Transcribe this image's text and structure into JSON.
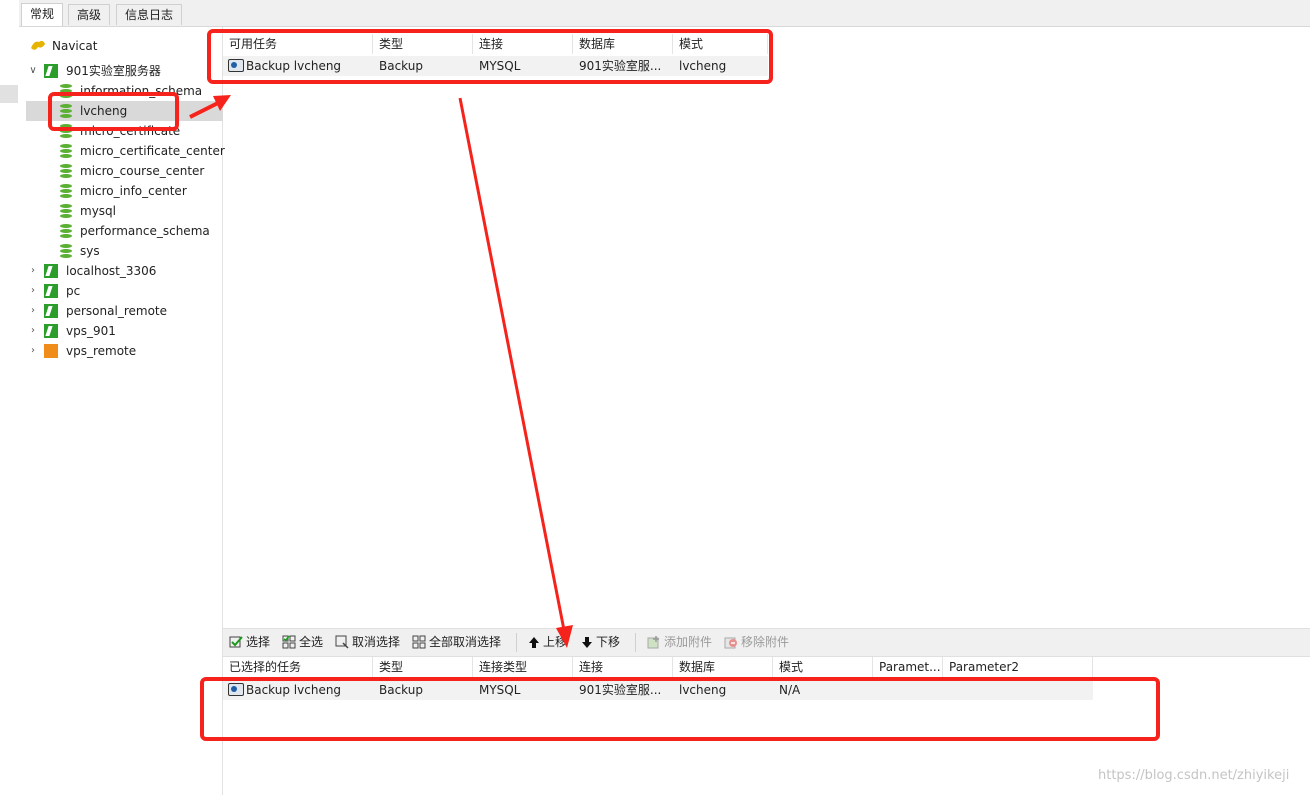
{
  "tabs": [
    {
      "label": "常规",
      "active": true
    },
    {
      "label": "高级",
      "active": false
    },
    {
      "label": "信息日志",
      "active": false
    }
  ],
  "tree": {
    "root": "Navicat",
    "server_expanded": "901实验室服务器",
    "databases": [
      "information_schema",
      "lvcheng",
      "micro_certificate",
      "micro_certificate_center",
      "micro_course_center",
      "micro_info_center",
      "mysql",
      "performance_schema",
      "sys"
    ],
    "selected_database": "lvcheng",
    "other_servers": [
      "localhost_3306",
      "pc",
      "personal_remote",
      "vps_901",
      "vps_remote"
    ]
  },
  "available_tasks": {
    "columns": [
      "可用任务",
      "类型",
      "连接",
      "数据库",
      "模式"
    ],
    "rows": [
      {
        "task": "Backup lvcheng",
        "type": "Backup",
        "connection": "MYSQL",
        "database": "901实验室服...",
        "schema": "lvcheng"
      }
    ]
  },
  "toolbar": {
    "select": "选择",
    "select_all": "全选",
    "deselect": "取消选择",
    "deselect_all": "全部取消选择",
    "move_up": "上移",
    "move_down": "下移",
    "add_attachment": "添加附件",
    "remove_attachment": "移除附件"
  },
  "selected_tasks": {
    "columns": [
      "已选择的任务",
      "类型",
      "连接类型",
      "连接",
      "数据库",
      "模式",
      "Paramet...",
      "Parameter2"
    ],
    "rows": [
      {
        "task": "Backup lvcheng",
        "type": "Backup",
        "connection_type": "MYSQL",
        "connection": "901实验室服...",
        "database": "lvcheng",
        "schema": "N/A",
        "param1": "",
        "param2": ""
      }
    ]
  },
  "watermark": "https://blog.csdn.net/zhiyikeji",
  "colors": {
    "annotation_red": "#f5231b",
    "mysql_icon_green": "#2a9d2a",
    "db_icon_green": "#5bb033",
    "remote_icon_orange": "#f08c1a"
  }
}
